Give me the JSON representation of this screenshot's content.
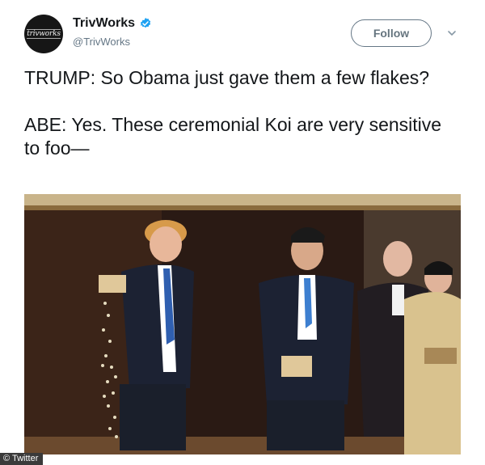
{
  "account": {
    "display_name": "TrivWorks",
    "handle": "@TrivWorks",
    "avatar_text": "trivworks",
    "verified": true
  },
  "follow_label": "Follow",
  "tweet": {
    "lines": [
      "TRUMP: So Obama just gave them a few flakes?",
      "ABE: Yes. These ceremonial Koi are very sensitive to foo—"
    ]
  },
  "watermark": "© Twitter",
  "colors": {
    "verified_blue": "#1da1f2",
    "follow_border": "#657786",
    "text": "#14171a",
    "handle": "#657786"
  },
  "icons": {
    "verified": "verified-badge-icon",
    "chevron": "chevron-down-icon"
  }
}
